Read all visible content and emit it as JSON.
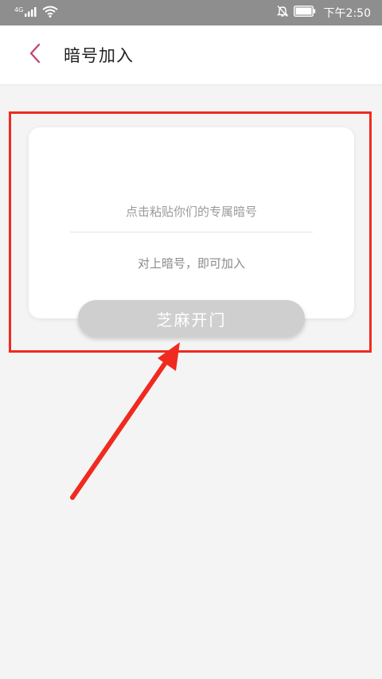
{
  "status_bar": {
    "network": "4G",
    "time": "下午2:50",
    "icons": [
      "signal-icon",
      "wifi-icon",
      "mute-bell-icon",
      "battery-icon"
    ]
  },
  "header": {
    "back_icon": "chevron-left-icon",
    "title": "暗号加入"
  },
  "card": {
    "input_placeholder": "点击粘贴你们的专属暗号",
    "input_value": "",
    "hint": "对上暗号，即可加入"
  },
  "join_button": {
    "label": "芝麻开门"
  },
  "colors": {
    "status_bar_bg": "#8e8e8e",
    "accent": "#c4416d",
    "button_disabled": "#cfcfcf",
    "annotation": "#f02a1f",
    "page_bg": "#f4f4f4"
  }
}
